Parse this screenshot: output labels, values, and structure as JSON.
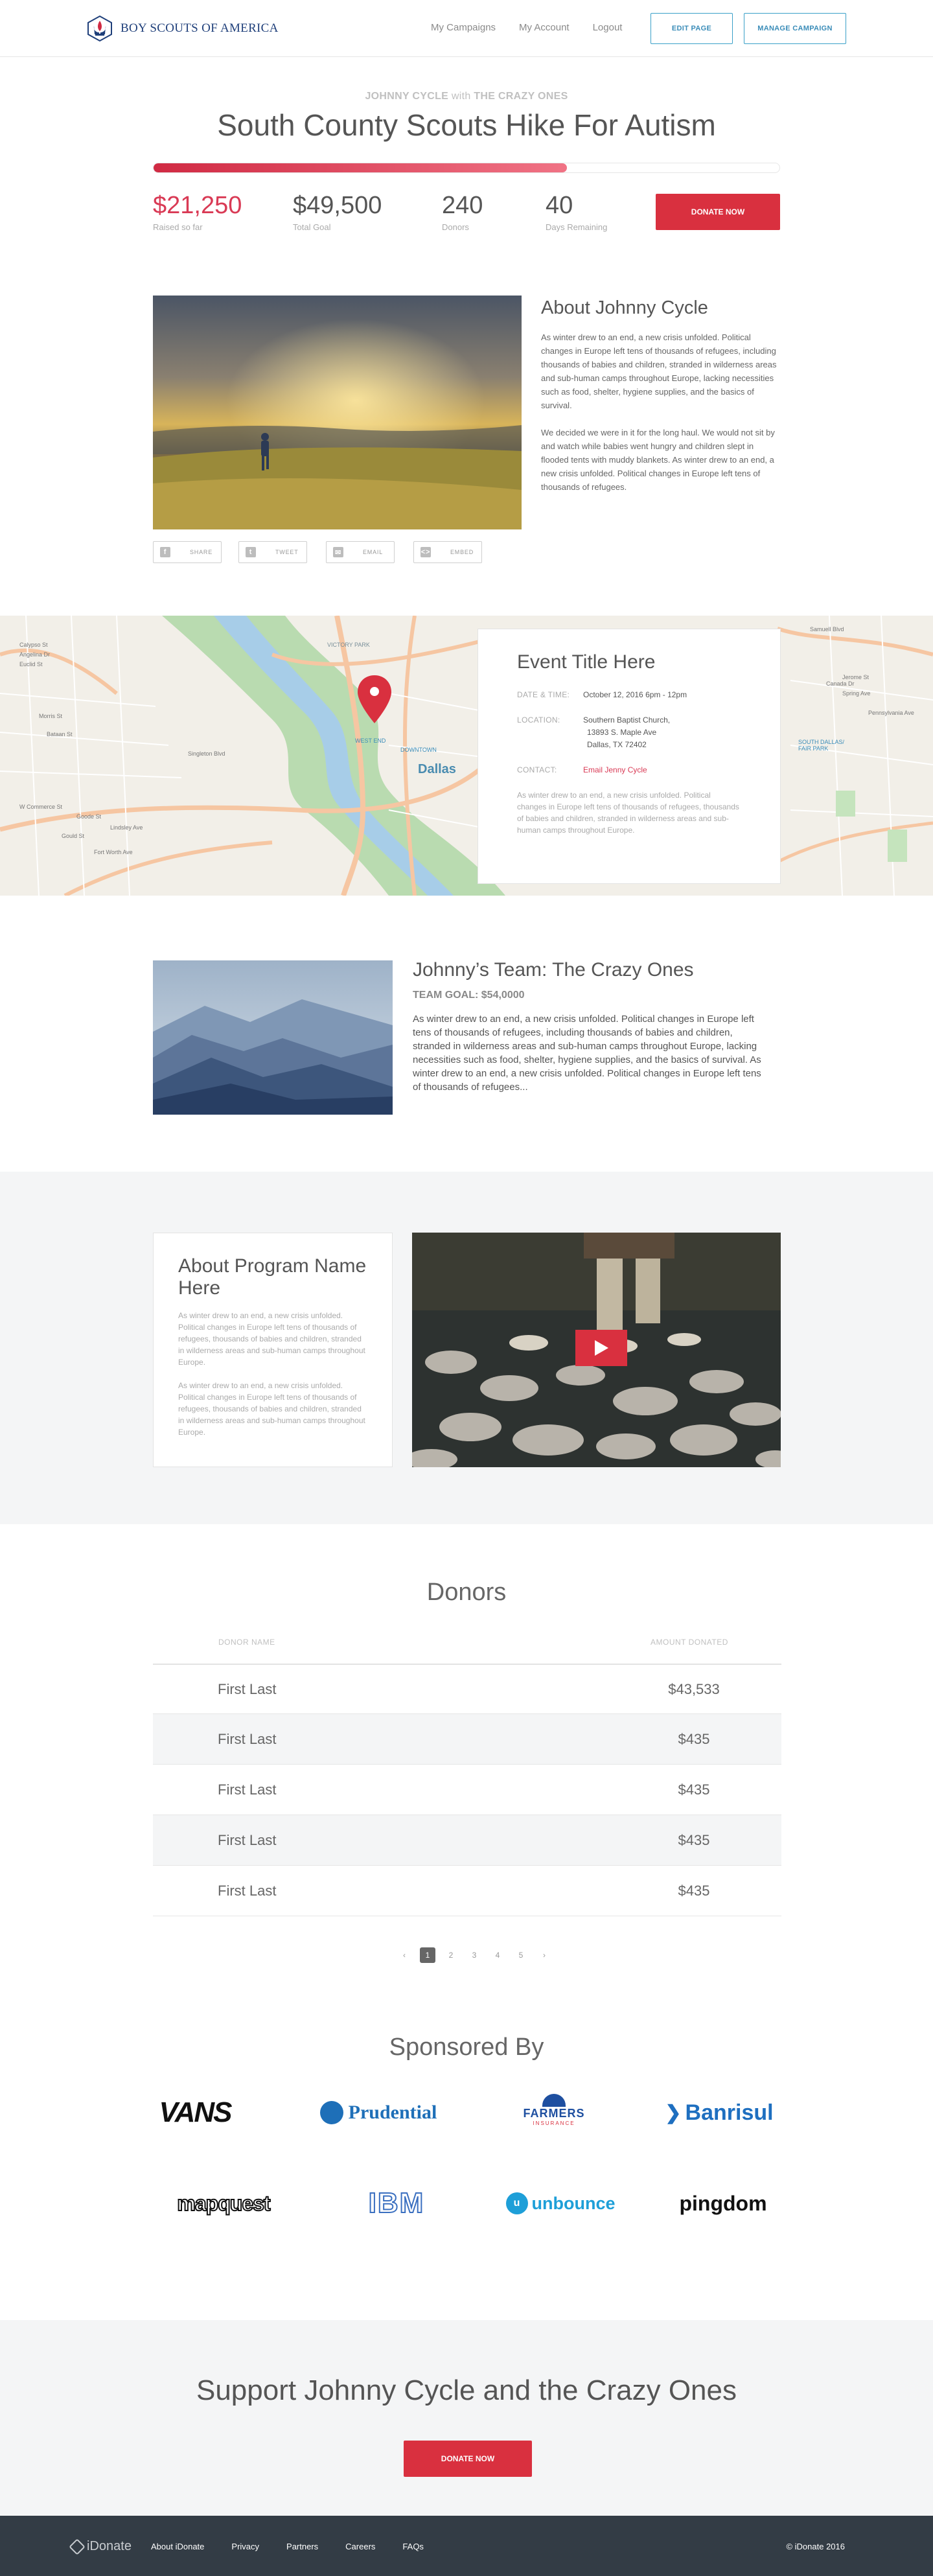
{
  "header": {
    "brand": "BOY SCOUTS OF AMERICA",
    "nav": [
      "My Campaigns",
      "My Account",
      "Logout"
    ],
    "edit_label": "EDIT PAGE",
    "manage_label": "MANAGE CAMPAIGN"
  },
  "hero": {
    "fundraiser": "JOHNNY CYCLE",
    "with": "with",
    "team": "THE CRAZY ONES",
    "title": "South County Scouts Hike For Autism",
    "progress": 0.66,
    "stats": [
      {
        "value": "$21,250",
        "label": "Raised so far"
      },
      {
        "value": "$49,500",
        "label": "Total Goal"
      },
      {
        "value": "240",
        "label": "Donors"
      },
      {
        "value": "40",
        "label": "Days Remaining"
      }
    ],
    "donate_label": "DONATE NOW"
  },
  "about": {
    "title": "About Johnny Cycle",
    "p1": "As winter drew to an end, a new crisis unfolded. Political changes in Europe left tens of thousands of refugees, including thousands of babies and children, stranded in wilderness areas and sub-human camps throughout Europe, lacking necessities such as food, shelter, hygiene supplies, and the basics of survival.",
    "p2": "We decided we were in it for the long haul. We would not sit by and watch while babies went hungry and children slept in flooded tents with muddy blankets. As winter drew to an end, a new crisis unfolded. Political changes in Europe left tens of thousands of refugees.",
    "share": [
      "SHARE",
      "TWEET",
      "EMAIL",
      "EMBED"
    ]
  },
  "map": {
    "labels": [
      "VICTORY PARK",
      "WEST END",
      "DOWNTOWN",
      "Dallas",
      "SOUTH DALLAS/ FAIR PARK",
      "Singleton Blvd",
      "W Commerce St",
      "Fort Worth Ave",
      "Samuell Blvd",
      "Canada Dr",
      "Pennsylvania Ave",
      "Jerome St",
      "Spring Ave",
      "Calypso St",
      "Angelina Dr",
      "Euclid St",
      "Morris St",
      "Bataan St",
      "Goode St",
      "Lindsley Ave",
      "Gould St"
    ]
  },
  "event": {
    "title": "Event Title Here",
    "date_label": "DATE & TIME:",
    "date": "October 12, 2016 6pm - 12pm",
    "location_label": "LOCATION:",
    "location_lines": [
      "Southern Baptist Church,",
      "13893 S. Maple Ave",
      "Dallas,  TX 72402"
    ],
    "contact_label": "CONTACT:",
    "contact": "Email Jenny Cycle",
    "desc": "As winter drew to an end, a new crisis unfolded. Political changes in Europe left tens of thousands of refugees, thousands of babies and children, stranded in wilderness areas and sub-human camps throughout Europe."
  },
  "team": {
    "title": "Johnny’s Team: The Crazy Ones",
    "goal_label": "TEAM GOAL:",
    "goal": "$54,0000",
    "text": "As winter drew to an end, a new crisis unfolded. Political changes in Europe left tens of thousands of refugees, including thousands of babies and children, stranded in wilderness areas and sub-human camps throughout Europe, lacking necessities such as food, shelter, hygiene supplies, and the basics of survival. As winter drew to an end, a new crisis unfolded. Political changes in Europe left tens of thousands of refugees..."
  },
  "program": {
    "title": "About Program Name Here",
    "p1": "As winter drew to an end, a new crisis unfolded. Political changes in Europe left tens of thousands of refugees,  thousands of babies and children, stranded in wilderness areas and sub-human camps throughout Europe.",
    "p2": " As winter drew to an end, a new crisis unfolded. Political changes in Europe left tens of thousands of refugees,  thousands of babies and children, stranded in wilderness areas and sub-human camps throughout Europe."
  },
  "donors": {
    "title": "Donors",
    "col_name": "DONOR NAME",
    "col_amount": "AMOUNT DONATED",
    "rows": [
      {
        "name": "First Last",
        "amount": "$43,533"
      },
      {
        "name": "First Last",
        "amount": "$435"
      },
      {
        "name": "First Last",
        "amount": "$435"
      },
      {
        "name": "First Last",
        "amount": "$435"
      },
      {
        "name": "First Last",
        "amount": "$435"
      }
    ],
    "pager": {
      "prev": "‹",
      "pages": [
        "1",
        "2",
        "3",
        "4",
        "5"
      ],
      "next": "›",
      "current": "1"
    }
  },
  "sponsors": {
    "title": "Sponsored By",
    "logos": [
      "VANS",
      "Prudential",
      "FARMERS",
      "INSURANCE",
      "Banrisul",
      "mapquest",
      "IBM",
      "unbounce",
      "pingdom"
    ]
  },
  "support": {
    "title": "Support Johnny Cycle and the Crazy Ones",
    "donate_label": "DONATE NOW"
  },
  "footer": {
    "brand": "iDonate",
    "links": [
      "About iDonate",
      "Privacy",
      "Partners",
      "Careers",
      "FAQs"
    ],
    "copyright": "© iDonate 2016"
  },
  "colors": {
    "accent_red": "#d9303f",
    "link_blue": "#3a8cb8",
    "footer_bg": "#333c45",
    "brand_navy": "#1f3f7a"
  }
}
